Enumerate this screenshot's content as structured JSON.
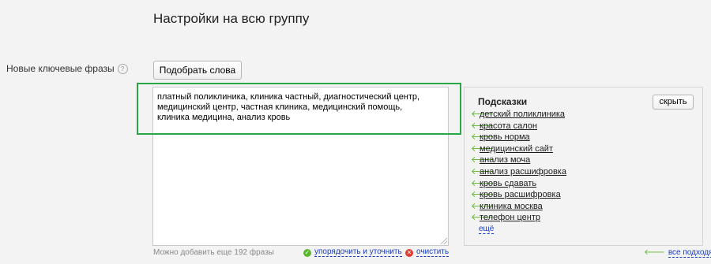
{
  "section": {
    "title": "Настройки на всю группу"
  },
  "field": {
    "label": "Новые ключевые фразы",
    "help_icon": "?"
  },
  "pick_words_button": "Подобрать слова",
  "keywords_text": "платный поликлиника, клиника частный, диагностический центр,\nмедицинский центр, частная клиника, медицинский помощь,\nклиника медицина, анализ кровь",
  "remaining_hint": "Можно добавить еще 192 фразы",
  "actions": {
    "sort_label": "упорядочить и уточнить",
    "sort_icon": "check-circle-icon",
    "clear_label": "очистить",
    "clear_icon": "x-circle-icon"
  },
  "hints": {
    "title": "Подсказки",
    "hide_button": "скрыть",
    "arrow_glyph": "🡐",
    "items": [
      "детский поликлиника",
      "красота салон",
      "кровь норма",
      "медицинский сайт",
      "анализ моча",
      "анализ расшифровка",
      "кровь сдавать",
      "кровь расшифровка",
      "клиника москва",
      "телефон центр"
    ],
    "more_link": "ещё",
    "all_fit_link": "все подходят"
  },
  "colors": {
    "highlight": "#27a844",
    "link": "#1a3dc1",
    "arrow": "#5cb531",
    "clear": "#e53a2f"
  }
}
